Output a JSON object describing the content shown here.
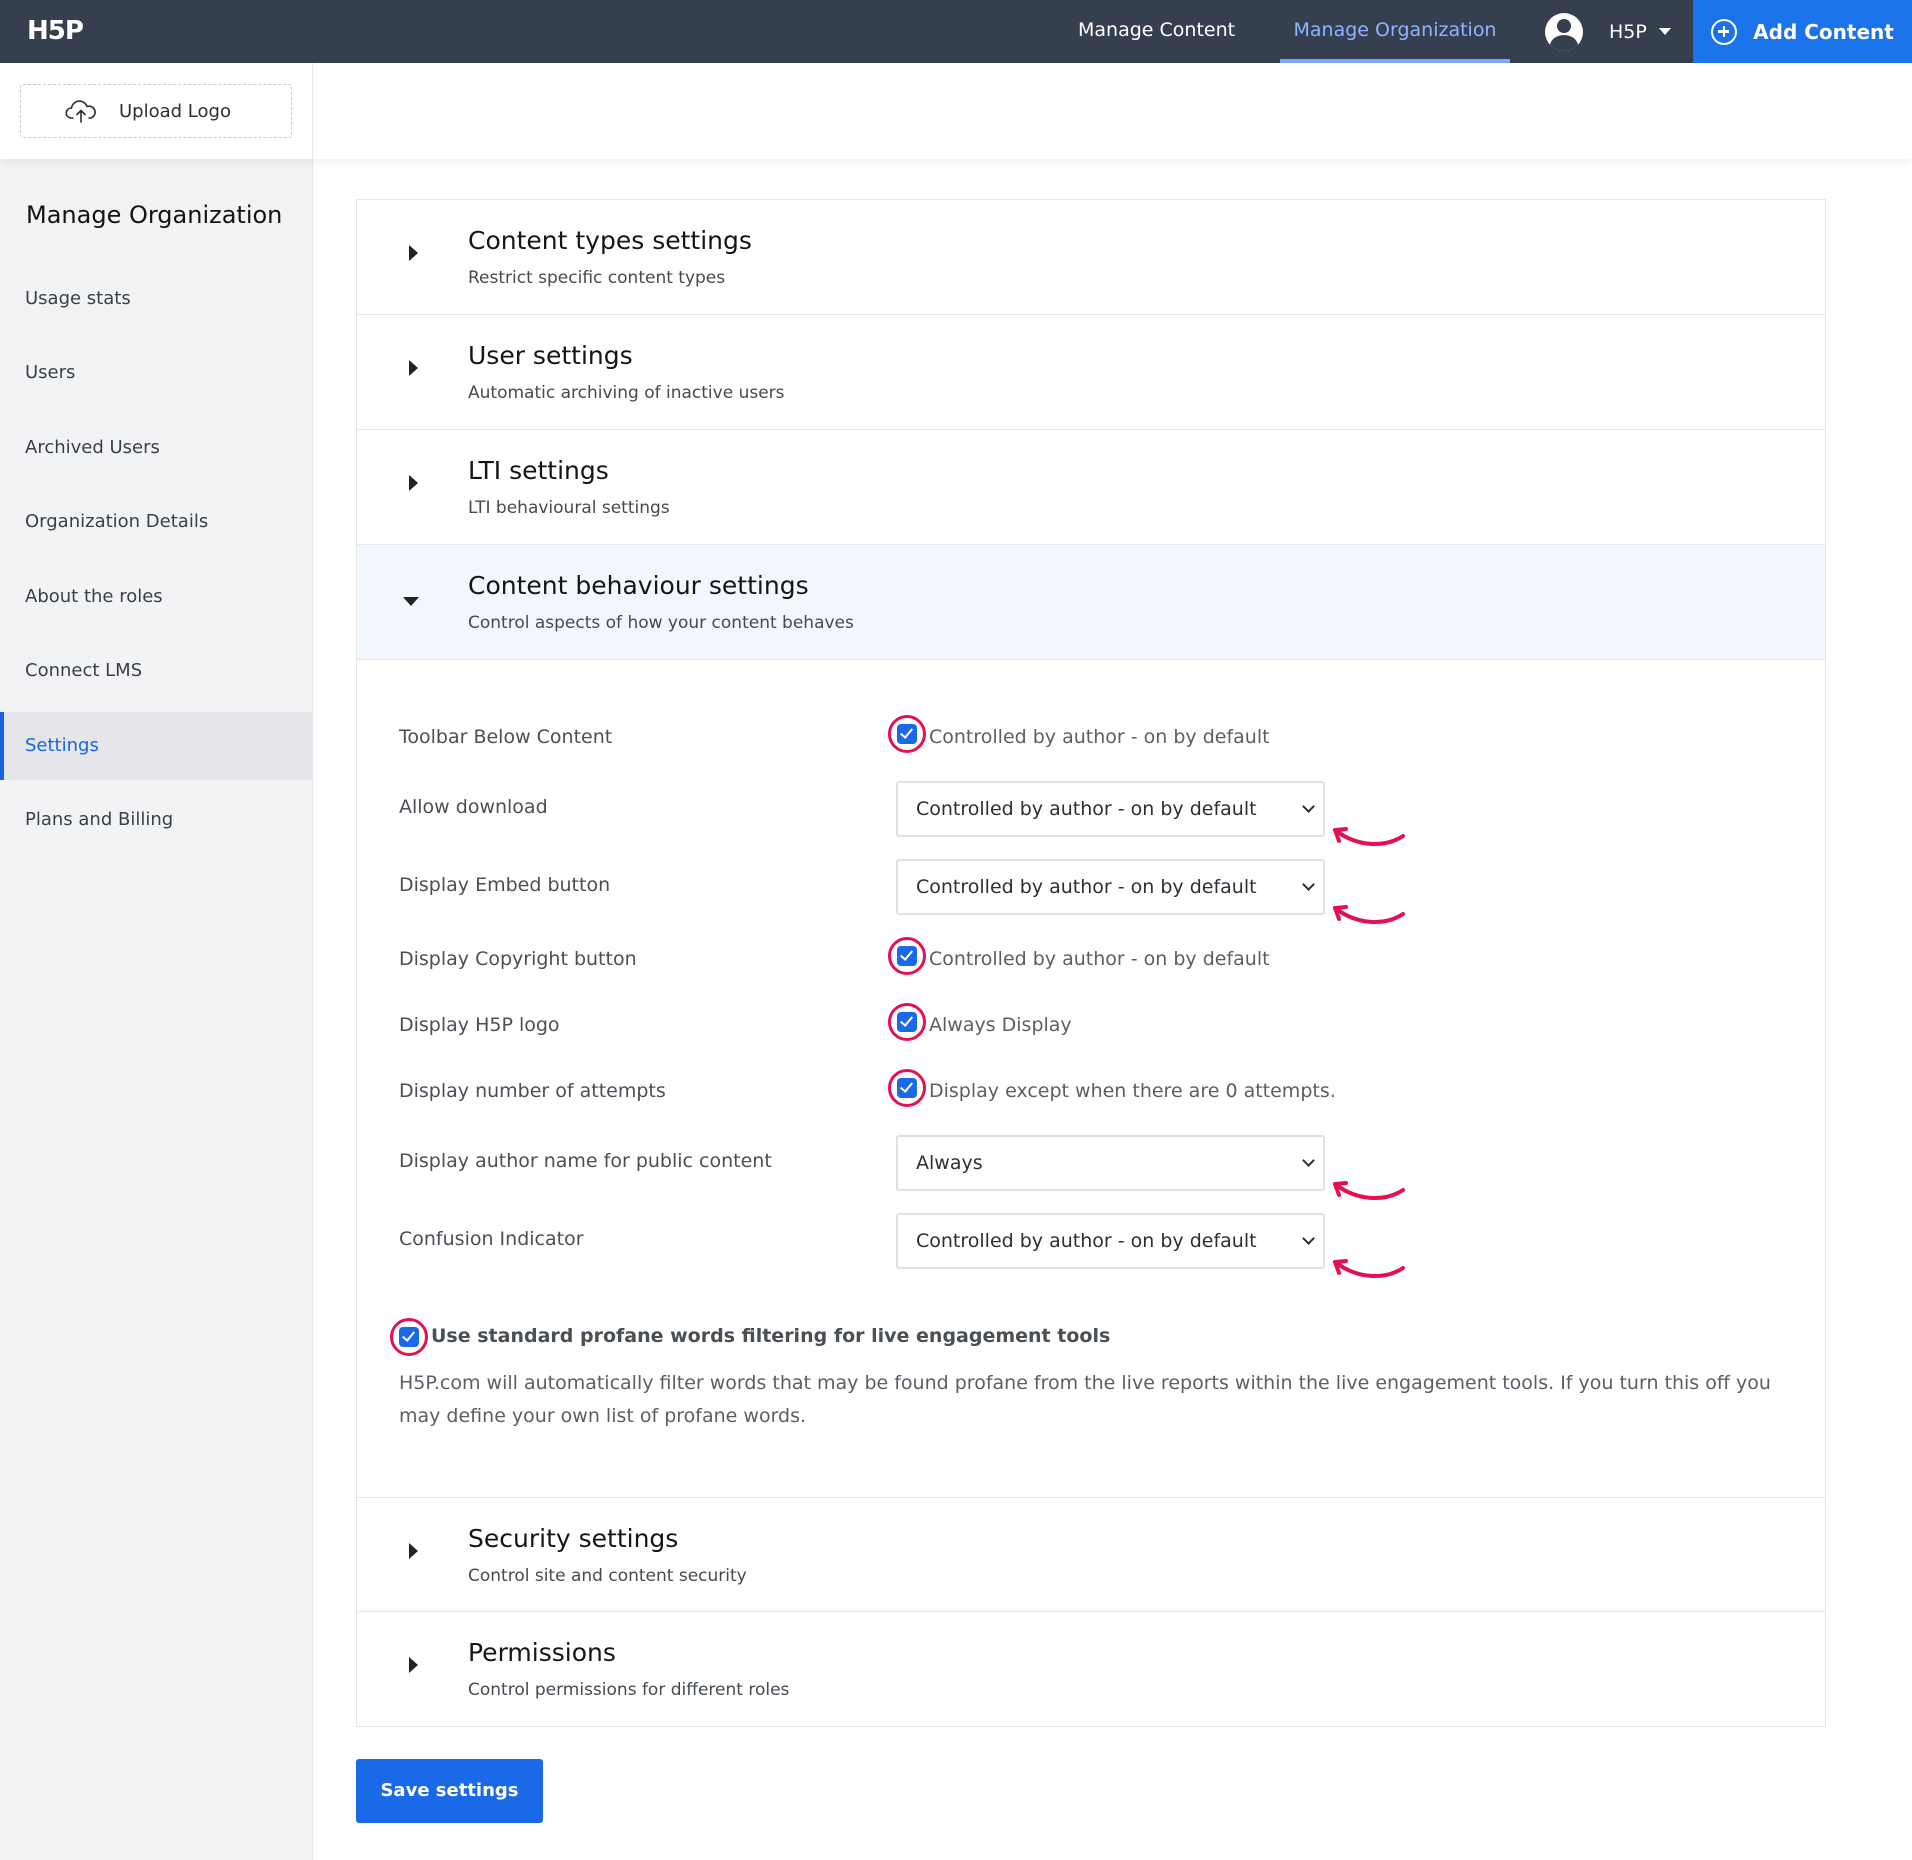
{
  "header": {
    "logo_text": "H5P",
    "nav": [
      {
        "label": "Manage Content"
      },
      {
        "label": "Manage Organization"
      }
    ],
    "user_name": "H5P",
    "add_content_label": "Add Content"
  },
  "logo_strip": {
    "upload_logo_label": "Upload Logo"
  },
  "sidebar": {
    "title": "Manage Organization",
    "items": [
      {
        "label": "Usage stats"
      },
      {
        "label": "Users"
      },
      {
        "label": "Archived Users"
      },
      {
        "label": "Organization Details"
      },
      {
        "label": "About the roles"
      },
      {
        "label": "Connect LMS"
      },
      {
        "label": "Settings"
      },
      {
        "label": "Plans and Billing"
      }
    ]
  },
  "sections": {
    "content_types": {
      "title": "Content types settings",
      "subtitle": "Restrict specific content types"
    },
    "user": {
      "title": "User settings",
      "subtitle": "Automatic archiving of inactive users"
    },
    "lti": {
      "title": "LTI settings",
      "subtitle": "LTI behavioural settings"
    },
    "content_behaviour": {
      "title": "Content behaviour settings",
      "subtitle": "Control aspects of how your content behaves"
    },
    "security": {
      "title": "Security settings",
      "subtitle": "Control site and content security"
    },
    "permissions": {
      "title": "Permissions",
      "subtitle": "Control permissions for different roles"
    }
  },
  "behaviour": {
    "toolbar_below_content": {
      "label": "Toolbar Below Content",
      "value": "Controlled by author - on by default"
    },
    "allow_download": {
      "label": "Allow download",
      "value": "Controlled by author - on by default"
    },
    "display_embed": {
      "label": "Display Embed button",
      "value": "Controlled by author - on by default"
    },
    "display_copyright": {
      "label": "Display Copyright button",
      "value": "Controlled by author - on by default"
    },
    "display_h5p_logo": {
      "label": "Display H5P logo",
      "value": "Always Display"
    },
    "display_attempts": {
      "label": "Display number of attempts",
      "value": "Display except when there are 0 attempts."
    },
    "display_author_name": {
      "label": "Display author name for public content",
      "value": "Always"
    },
    "confusion_indicator": {
      "label": "Confusion Indicator",
      "value": "Controlled by author - on by default"
    },
    "profane_filter": {
      "label": "Use standard profane words filtering for live engagement tools",
      "description": "H5P.com will automatically filter words that may be found profane from the live reports within the live engagement tools. If you turn this off you may define your own list of profane words."
    }
  },
  "save_label": "Save settings",
  "colors": {
    "topbar": "#363f50",
    "accent": "#1a6ae8",
    "annotation": "#e5104f",
    "active_nav": "#8fb4ff"
  }
}
